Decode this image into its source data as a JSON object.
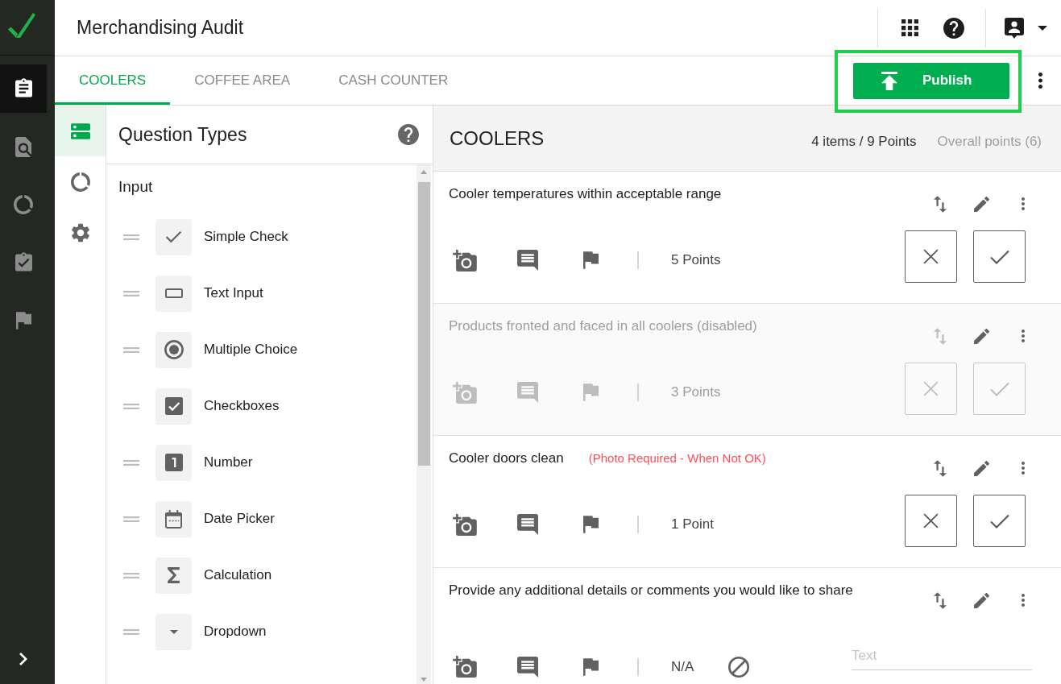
{
  "nav_rail": {
    "items": [
      {
        "selected": true
      },
      {
        "selected": false
      },
      {
        "selected": false
      },
      {
        "selected": false
      },
      {
        "selected": false
      }
    ]
  },
  "header": {
    "title": "Merchandising Audit"
  },
  "tabs": [
    {
      "label": "COOLERS",
      "selected": true
    },
    {
      "label": "COFFEE AREA",
      "selected": false
    },
    {
      "label": "CASH COUNTER",
      "selected": false
    }
  ],
  "publish_button": {
    "label": "Publish",
    "highlighted": true
  },
  "tool_rail": {
    "items": [
      {
        "selected": true
      },
      {
        "selected": false
      },
      {
        "selected": false
      }
    ]
  },
  "question_types": {
    "title": "Question Types",
    "section_label": "Input",
    "items": [
      {
        "label": "Simple Check"
      },
      {
        "label": "Text Input"
      },
      {
        "label": "Multiple Choice"
      },
      {
        "label": "Checkboxes"
      },
      {
        "label": "Number"
      },
      {
        "label": "Date Picker"
      },
      {
        "label": "Calculation"
      },
      {
        "label": "Dropdown"
      }
    ]
  },
  "section": {
    "title": "COOLERS",
    "summary": "4 items / 9 Points",
    "overall_points": "Overall points (6)",
    "questions": [
      {
        "kind": "pass_fail",
        "title": "Cooler temperatures within acceptable range",
        "disabled": false,
        "points": "5 Points"
      },
      {
        "kind": "pass_fail",
        "title": "Products fronted and faced in all coolers (disabled)",
        "disabled": true,
        "points": "3 Points"
      },
      {
        "kind": "pass_fail",
        "title": "Cooler doors clean",
        "note": "(Photo Required - When Not OK)",
        "disabled": false,
        "points": "1 Point"
      },
      {
        "kind": "text",
        "title": "Provide any additional details or comments you would like to share",
        "disabled": false,
        "points": "N/A",
        "placeholder": "Text"
      }
    ]
  }
}
